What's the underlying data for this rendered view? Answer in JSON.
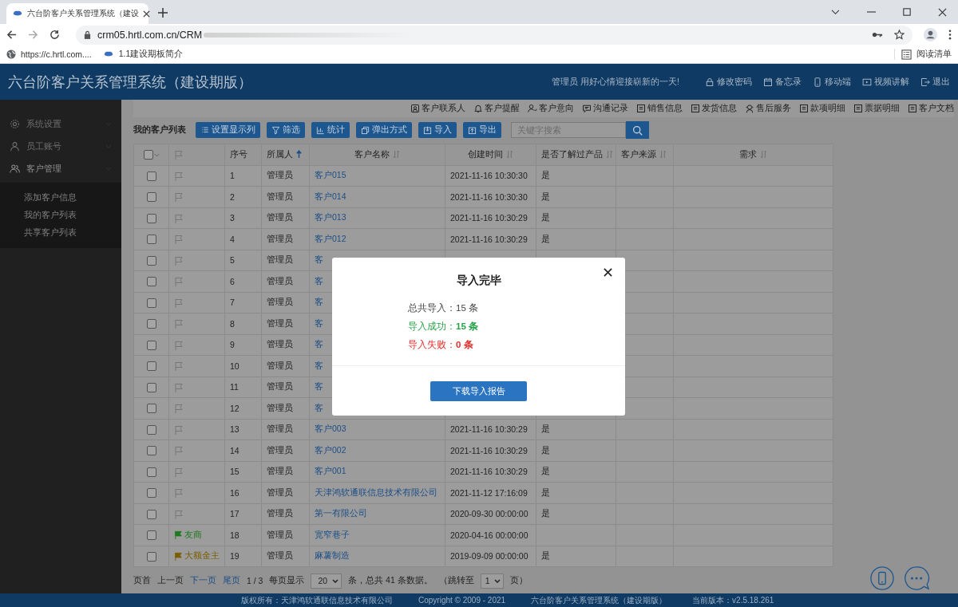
{
  "browser": {
    "tab_title": "六台阶客户关系管理系统（建设",
    "address": "crm05.hrtl.com.cn/CRM",
    "bookmarks": [
      {
        "kind": "globe",
        "label": "https://c.hrtl.com...."
      },
      {
        "kind": "logo",
        "label": "1.1建设期板简介"
      }
    ],
    "reading_list": "阅读清单"
  },
  "header": {
    "title": "六台阶客户关系管理系统（建设期版）",
    "greeting": "管理员 用好心情迎接崭新的一天!",
    "links": [
      {
        "kind": "lock",
        "label": "修改密码"
      },
      {
        "kind": "calendar",
        "label": "备忘录"
      },
      {
        "kind": "phone",
        "label": "移动端"
      },
      {
        "kind": "video",
        "label": "视频讲解"
      },
      {
        "kind": "exit",
        "label": "退出"
      }
    ]
  },
  "sidebar": {
    "groups": [
      {
        "kind": "settings",
        "label": "系统设置",
        "expanded": false
      },
      {
        "kind": "staff",
        "label": "员工账号",
        "expanded": false
      },
      {
        "kind": "customers",
        "label": "客户管理",
        "expanded": true,
        "children": [
          "添加客户信息",
          "我的客户列表",
          "共享客户列表"
        ]
      }
    ]
  },
  "top_links": [
    {
      "kind": "contact",
      "label": "客户联系人"
    },
    {
      "kind": "bell",
      "label": "客户提醒"
    },
    {
      "kind": "intent",
      "label": "客户意向"
    },
    {
      "kind": "chat",
      "label": "沟通记录"
    },
    {
      "kind": "doc",
      "label": "销售信息"
    },
    {
      "kind": "doc",
      "label": "发货信息"
    },
    {
      "kind": "service",
      "label": "售后服务"
    },
    {
      "kind": "doc",
      "label": "款项明细"
    },
    {
      "kind": "doc",
      "label": "票据明细"
    },
    {
      "kind": "doc",
      "label": "客户文档"
    }
  ],
  "toolbar": {
    "title": "我的客户列表",
    "buttons": [
      {
        "kind": "list",
        "label": "设置显示列"
      },
      {
        "kind": "filter",
        "label": "筛选"
      },
      {
        "kind": "chart",
        "label": "统计"
      },
      {
        "kind": "copy",
        "label": "弹出方式"
      },
      {
        "kind": "import",
        "label": "导入"
      },
      {
        "kind": "export",
        "label": "导出"
      }
    ],
    "search": {
      "placeholder": "关键字搜索"
    }
  },
  "table": {
    "columns": [
      {
        "kind": "check",
        "checked": false
      },
      {
        "kind": "flag"
      },
      {
        "kind": "text",
        "label": "序号"
      },
      {
        "kind": "text",
        "label": "所属人",
        "sorted": true
      },
      {
        "kind": "text",
        "label": "客户名称",
        "sorted": false
      },
      {
        "kind": "text",
        "label": "创建时间",
        "sorted": false
      },
      {
        "kind": "text",
        "label": "是否了解过产品",
        "sorted": false
      },
      {
        "kind": "text",
        "label": "客户来源",
        "sorted": false
      },
      {
        "kind": "text",
        "label": "需求",
        "sorted": false
      }
    ],
    "rows": [
      {
        "checked": false,
        "no": "1",
        "owner": "管理员",
        "name": "客户015",
        "created": "2021-11-16 10:30:30",
        "known": "是"
      },
      {
        "checked": false,
        "no": "2",
        "owner": "管理员",
        "name": "客户014",
        "created": "2021-11-16 10:30:30",
        "known": "是"
      },
      {
        "checked": false,
        "no": "3",
        "owner": "管理员",
        "name": "客户013",
        "created": "2021-11-16 10:30:29",
        "known": "是"
      },
      {
        "checked": false,
        "no": "4",
        "owner": "管理员",
        "name": "客户012",
        "created": "2021-11-16 10:30:29",
        "known": "是"
      },
      {
        "checked": false,
        "no": "5",
        "owner": "管理员",
        "name": "客"
      },
      {
        "checked": false,
        "no": "6",
        "owner": "管理员",
        "name": "客"
      },
      {
        "checked": false,
        "no": "7",
        "owner": "管理员",
        "name": "客"
      },
      {
        "checked": false,
        "no": "8",
        "owner": "管理员",
        "name": "客"
      },
      {
        "checked": false,
        "no": "9",
        "owner": "管理员",
        "name": "客"
      },
      {
        "checked": false,
        "no": "10",
        "owner": "管理员",
        "name": "客"
      },
      {
        "checked": false,
        "no": "11",
        "owner": "管理员",
        "name": "客"
      },
      {
        "checked": false,
        "no": "12",
        "owner": "管理员",
        "name": "客"
      },
      {
        "checked": false,
        "no": "13",
        "owner": "管理员",
        "name": "客户003",
        "created": "2021-11-16 10:30:29",
        "known": "是"
      },
      {
        "checked": false,
        "no": "14",
        "owner": "管理员",
        "name": "客户002",
        "created": "2021-11-16 10:30:29",
        "known": "是"
      },
      {
        "checked": false,
        "no": "15",
        "owner": "管理员",
        "name": "客户001",
        "created": "2021-11-16 10:30:29",
        "known": "是"
      },
      {
        "checked": false,
        "no": "16",
        "owner": "管理员",
        "name": "天津鸿软通联信息技术有限公司",
        "created": "2021-11-12 17:16:09",
        "known": "是"
      },
      {
        "checked": false,
        "no": "17",
        "owner": "管理员",
        "name": "第一有限公司",
        "created": "2020-09-30 00:00:00",
        "known": "是"
      },
      {
        "checked": false,
        "tag": {
          "label": "友商",
          "color": "#1f7a1f"
        },
        "no": "18",
        "owner": "管理员",
        "name": "宽窄巷子",
        "created": "2020-04-16 00:00:00"
      },
      {
        "checked": false,
        "tag": {
          "label": "大额金主",
          "color": "#7a5e00"
        },
        "no": "19",
        "owner": "管理员",
        "name": "麻薯制造",
        "created": "2019-09-09 00:00:00",
        "known": "是"
      }
    ]
  },
  "pager": {
    "links": [
      {
        "label": "页首",
        "disabled": true
      },
      {
        "label": "上一页",
        "disabled": true
      },
      {
        "label": "下一页",
        "disabled": false
      },
      {
        "label": "尾页",
        "disabled": false
      }
    ],
    "page": "1 / 3",
    "per_page_label": "每页显示",
    "per_page": "20",
    "total": "条，总共 41 条数据。",
    "jump_label": "（跳转至",
    "jump": "1",
    "jump_end": "页）"
  },
  "footer": [
    "版权所有：天津鸿软通联信息技术有限公司",
    "Copyright © 2009 - 2021",
    "六台阶客户关系管理系统（建设期版）",
    "当前版本：v2.5.18.261"
  ],
  "dialog": {
    "title": "导入完毕",
    "lines": [
      {
        "kind": "total",
        "text": "总共导入：15 条"
      },
      {
        "kind": "success",
        "text": "导入成功：**15 条**"
      },
      {
        "kind": "fail",
        "text": "导入失败：**0 条**"
      }
    ],
    "button": "下载导入报告"
  }
}
